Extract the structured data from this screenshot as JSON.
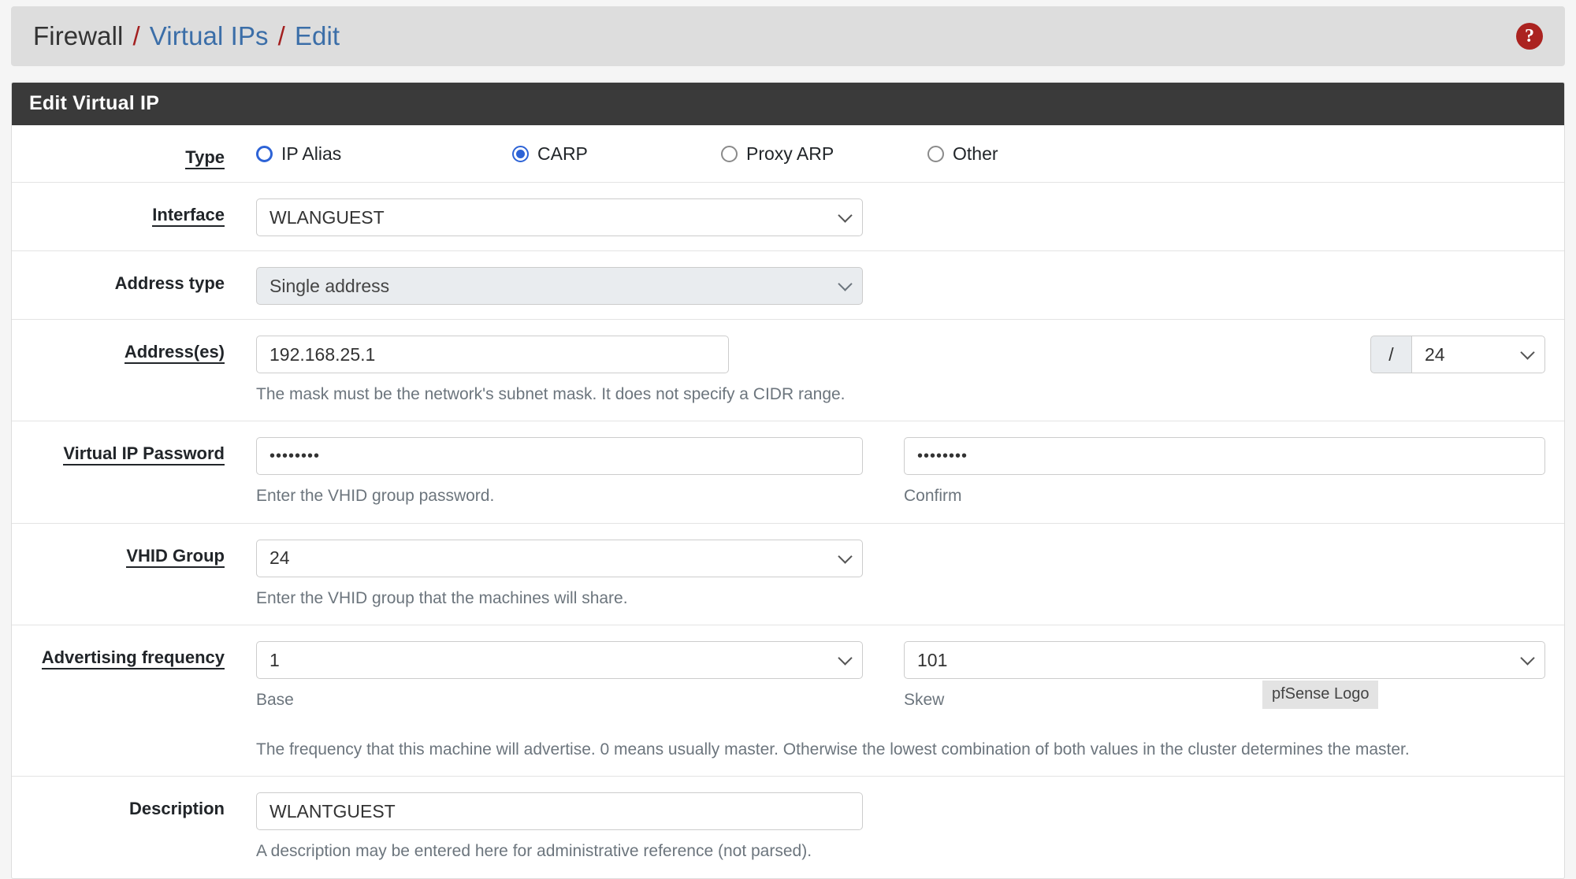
{
  "breadcrumb": {
    "root": "Firewall",
    "section": "Virtual IPs",
    "page": "Edit",
    "separator": "/",
    "help_icon": "help-circle-icon",
    "help_glyph": "?"
  },
  "panel": {
    "title": "Edit Virtual IP"
  },
  "form": {
    "type": {
      "label": "Type",
      "options": [
        {
          "label": "IP Alias",
          "state": "ring"
        },
        {
          "label": "CARP",
          "state": "checked"
        },
        {
          "label": "Proxy ARP",
          "state": "unchecked"
        },
        {
          "label": "Other",
          "state": "unchecked"
        }
      ]
    },
    "interface": {
      "label": "Interface",
      "value": "WLANGUEST"
    },
    "address_type": {
      "label": "Address type",
      "value": "Single address"
    },
    "addresses": {
      "label": "Address(es)",
      "value": "192.168.25.1",
      "cidr_prefix": "/",
      "cidr_value": "24",
      "help": "The mask must be the network's subnet mask. It does not specify a CIDR range."
    },
    "vip_password": {
      "label": "Virtual IP Password",
      "value": "••••••••",
      "help": "Enter the VHID group password.",
      "confirm_value": "••••••••",
      "confirm_help": "Confirm"
    },
    "vhid_group": {
      "label": "VHID Group",
      "value": "24",
      "help": "Enter the VHID group that the machines will share."
    },
    "advertising_frequency": {
      "label": "Advertising frequency",
      "base_value": "1",
      "base_help": "Base",
      "skew_value": "101",
      "skew_help": "Skew",
      "help": "The frequency that this machine will advertise. 0 means usually master. Otherwise the lowest combination of both values in the cluster determines the master."
    },
    "description": {
      "label": "Description",
      "value": "WLANTGUEST",
      "help": "A description may be entered here for administrative reference (not parsed)."
    }
  },
  "overlay": {
    "logo_tooltip": "pfSense Logo"
  }
}
